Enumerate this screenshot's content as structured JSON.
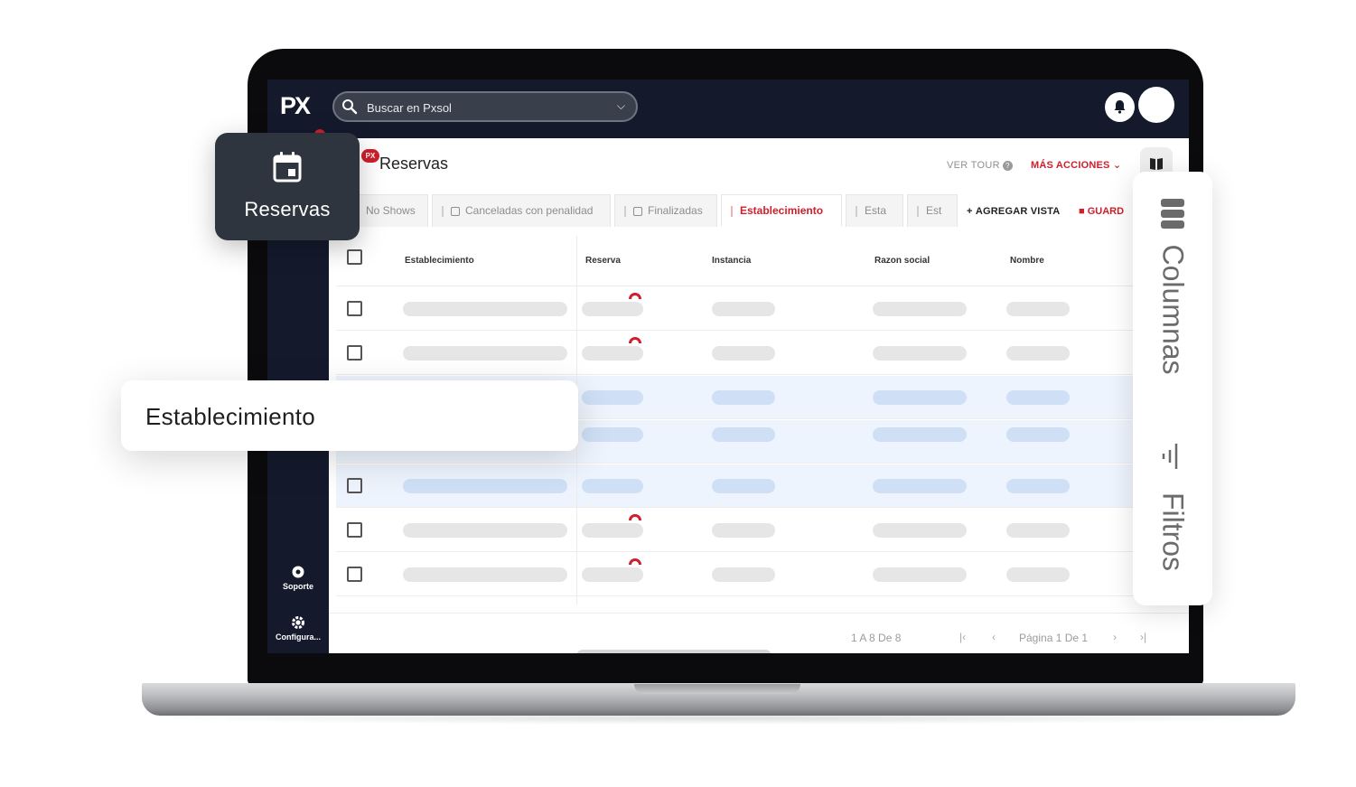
{
  "app": {
    "logo": "PX",
    "search_placeholder": "Buscar en Pxsol"
  },
  "nav": {
    "support_label": "Soporte",
    "config_label": "Configura..."
  },
  "page": {
    "badge": "PX",
    "title": "Reservas",
    "tour_label": "VER TOUR",
    "more_actions_label": "MÁS ACCIONES",
    "tabs": [
      {
        "label": "No Shows"
      },
      {
        "label": "Canceladas con penalidad"
      },
      {
        "label": "Finalizadas"
      },
      {
        "label": "Establecimiento"
      },
      {
        "label": "Esta"
      },
      {
        "label": "Est"
      }
    ],
    "add_view_label": "AGREGAR VISTA",
    "save_view_label": "GUARD"
  },
  "table": {
    "columns": [
      "Establecimiento",
      "Reserva",
      "Instancia",
      "Razon social",
      "Nombre"
    ]
  },
  "pager": {
    "range": "1 A 8 De 8",
    "page": "Página 1 De 1"
  },
  "overlays": {
    "reservas_label": "Reservas",
    "establecimiento_label": "Establecimiento",
    "columns_label": "Columnas",
    "filters_label": "Filtros"
  },
  "colors": {
    "navy": "#141a2c",
    "accent_red": "#cf1f2b",
    "highlight_row": "#eef4fd"
  }
}
